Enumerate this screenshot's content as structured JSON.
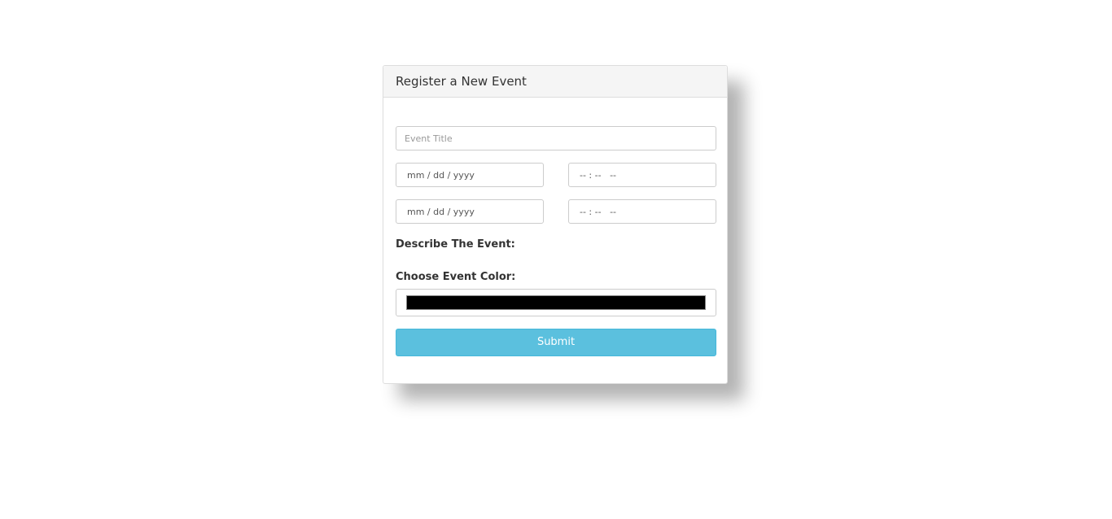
{
  "form": {
    "heading": "Register a New Event",
    "title_placeholder": "Event Title",
    "start_date_placeholder": "mm / dd / yyyy",
    "start_time_placeholder": "-- : --   --",
    "end_date_placeholder": "mm / dd / yyyy",
    "end_time_placeholder": "-- : --   --",
    "describe_label": "Describe The Event:",
    "color_label": "Choose Event Color:",
    "color_value": "#000000",
    "submit_label": "Submit"
  },
  "colors": {
    "accent": "#5bc0de",
    "panel_heading_bg": "#f5f5f5"
  }
}
